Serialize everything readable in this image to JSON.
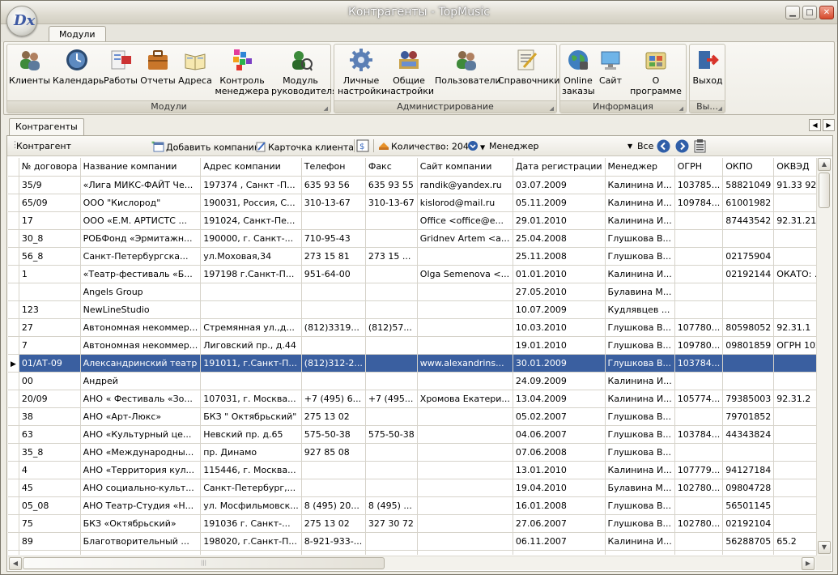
{
  "window": {
    "title": "Контрагенты - TopMusic",
    "logo_text": "Dx"
  },
  "ribbon": {
    "tab": "Модули",
    "groups": {
      "modules": {
        "caption": "Модули",
        "buttons": [
          {
            "label": "Клиенты",
            "icon": "clients-icon"
          },
          {
            "label": "Календарь",
            "icon": "calendar-icon"
          },
          {
            "label": "Работы",
            "icon": "works-icon"
          },
          {
            "label": "Отчеты",
            "icon": "reports-icon"
          },
          {
            "label": "Адреса",
            "icon": "addresses-icon"
          },
          {
            "label": "Контроль менеджера",
            "icon": "manager-control-icon"
          },
          {
            "label": "Модуль руководителя",
            "icon": "director-module-icon"
          }
        ]
      },
      "admin": {
        "caption": "Администрирование",
        "buttons": [
          {
            "label": "Личные настройки",
            "icon": "personal-settings-icon"
          },
          {
            "label": "Общие настройки",
            "icon": "general-settings-icon"
          },
          {
            "label": "Пользователи",
            "icon": "users-icon"
          },
          {
            "label": "Справочники",
            "icon": "directories-icon"
          }
        ]
      },
      "info": {
        "caption": "Информация",
        "buttons": [
          {
            "label": "Online заказы",
            "icon": "online-orders-icon"
          },
          {
            "label": "Сайт",
            "icon": "site-icon"
          },
          {
            "label": "О программе",
            "icon": "about-icon"
          }
        ]
      },
      "exit": {
        "caption": "Вы...",
        "buttons": [
          {
            "label": "Выход",
            "icon": "exit-icon"
          }
        ]
      }
    }
  },
  "doc_tab": "Контрагенты",
  "toolbar": {
    "title": "Контрагент",
    "add_company": "Добавить компанию",
    "client_card": "Карточка клиента",
    "count_label": "Количество: 204",
    "manager_label": "Менеджер",
    "filter_value": "Все"
  },
  "grid": {
    "columns": [
      "№ договора",
      "Название компании",
      "Адрес компании",
      "Телефон",
      "Факс",
      "Сайт компании",
      "Дата регистрации",
      "Менеджер",
      "ОГРН",
      "ОКПО",
      "ОКВЭД"
    ],
    "selected_row": 10,
    "rows": [
      [
        "35/9",
        "«Лига МИКС-ФАЙТ Че...",
        "197374 , Санкт -П...",
        "635 93 56",
        "635 93 55",
        "randik@yandex.ru",
        "03.07.2009",
        "Калинина И...",
        "103785...",
        "58821049",
        "91.33  92..."
      ],
      [
        "65/09",
        "ООО \"Кислород\"",
        "190031, Россия, С...",
        "310-13-67",
        "310-13-67",
        "kislorod@mail.ru",
        "05.11.2009",
        "Калинина И...",
        "109784...",
        "61001982",
        ""
      ],
      [
        "17",
        "ООО «Е.М. АРТИСТС ...",
        "191024, Санкт-Пе...",
        "",
        "",
        "Office <office@e...",
        "29.01.2010",
        "Калинина И...",
        "",
        "87443542",
        "92.31.21"
      ],
      [
        "30_8",
        "РОБФонд «Эрмитажн...",
        "190000, г. Санкт-...",
        "710-95-43",
        "",
        "Gridnev Artem <a...",
        "25.04.2008",
        "Глушкова В...",
        "",
        "",
        ""
      ],
      [
        "56_8",
        "Санкт-Петербургска...",
        "ул.Моховая,34",
        "273 15 81",
        "273 15 ...",
        "",
        "25.11.2008",
        "Глушкова В...",
        "",
        "02175904",
        ""
      ],
      [
        "1",
        "«Театр-фестиваль «Б...",
        "197198  г.Санкт-П...",
        "951-64-00",
        "",
        "Olga Semenova <...",
        "01.01.2010",
        "Калинина И...",
        "",
        "02192144",
        "ОКАТО: ..."
      ],
      [
        "",
        "Angels Group",
        "",
        "",
        "",
        "",
        "27.05.2010",
        "Булавина М...",
        "",
        "",
        ""
      ],
      [
        "123",
        "NewLineStudio",
        "",
        "",
        "",
        "",
        "10.07.2009",
        "Кудлявцев ...",
        "",
        "",
        ""
      ],
      [
        "27",
        "Автономная некоммер...",
        "Стремянная ул.,д...",
        "(812)3319...",
        "(812)57...",
        "",
        "10.03.2010",
        "Глушкова В...",
        "107780...",
        "80598052",
        "92.31.1"
      ],
      [
        "7",
        "Автономная некоммер...",
        "Лиговский пр., д.44",
        "",
        "",
        "",
        "19.01.2010",
        "Глушкова В...",
        "109780...",
        "09801859",
        "ОГРН 102..."
      ],
      [
        "01/АТ-09",
        "Александринский театр",
        "191011, г.Санкт-П...",
        "(812)312-2...",
        "",
        "www.alexandrins...",
        "30.01.2009",
        "Глушкова В...",
        "103784...",
        "",
        ""
      ],
      [
        "00",
        "Андрей",
        "",
        "",
        "",
        "",
        "24.09.2009",
        "Калинина И...",
        "",
        "",
        ""
      ],
      [
        "20/09",
        "АНО « Фестиваль «Зо...",
        "107031, г. Москва...",
        "+7 (495) 6...",
        "+7 (495...",
        "Хромова Екатери...",
        "13.04.2009",
        "Калинина И...",
        "105774...",
        "79385003",
        "92.31.2"
      ],
      [
        "38",
        "АНО «Арт-Люкс»",
        "БКЗ \" Октябрьский\"",
        "275 13 02",
        "",
        "",
        "05.02.2007",
        "Глушкова В...",
        "",
        "79701852",
        ""
      ],
      [
        "63",
        "АНО «Культурный це...",
        "Невский пр. д.65",
        "575-50-38",
        "575-50-38",
        "",
        "04.06.2007",
        "Глушкова В...",
        "103784...",
        "44343824",
        ""
      ],
      [
        "35_8",
        "АНО «Международны...",
        "пр. Динамо",
        "927 85 08",
        "",
        "",
        "07.06.2008",
        "Глушкова В...",
        "",
        "",
        ""
      ],
      [
        "4",
        "АНО «Территория кул...",
        "115446, г. Москва...",
        "",
        "",
        "",
        "13.01.2010",
        "Калинина И...",
        "107779...",
        "94127184",
        ""
      ],
      [
        "45",
        "АНО социально-культ...",
        "Санкт-Петербург,...",
        "",
        "",
        "",
        "19.04.2010",
        "Булавина М...",
        "102780...",
        "09804728",
        ""
      ],
      [
        "05_08",
        "АНО Театр-Студия «Н...",
        "ул. Мосфильмовск...",
        "8 (495) 20...",
        "8 (495) ...",
        "",
        "16.01.2008",
        "Глушкова В...",
        "",
        "56501145",
        ""
      ],
      [
        "75",
        "БКЗ «Октябрьский»",
        "191036  г. Санкт-...",
        "275 13 02",
        "327 30 72",
        "",
        "27.06.2007",
        "Глушкова В...",
        "102780...",
        "02192104",
        ""
      ],
      [
        "89",
        "Благотворительный ...",
        "198020, г.Санкт-П...",
        "8-921-933-...",
        "",
        "",
        "06.11.2007",
        "Калинина И...",
        "",
        "56288705",
        "65.2"
      ],
      [
        "",
        "",
        "",
        "",
        "",
        "",
        "",
        "",
        "",
        "",
        ""
      ]
    ]
  }
}
